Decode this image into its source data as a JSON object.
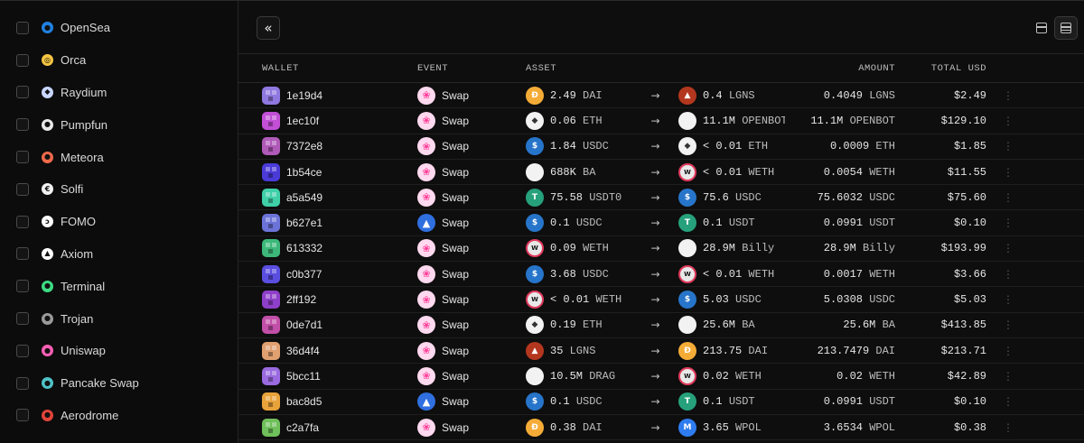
{
  "sidebar": {
    "items": [
      {
        "label": "OpenSea",
        "icon": "opensea-icon",
        "color": "#2081e2",
        "glyph": "●"
      },
      {
        "label": "Orca",
        "icon": "orca-icon",
        "color": "#f5c542",
        "glyph": "◎"
      },
      {
        "label": "Raydium",
        "icon": "raydium-icon",
        "color": "#c9d6ff",
        "glyph": "◆"
      },
      {
        "label": "Pumpfun",
        "icon": "pumpfun-icon",
        "color": "#e8e8e8",
        "glyph": "●"
      },
      {
        "label": "Meteora",
        "icon": "meteora-icon",
        "color": "#f06a4a",
        "glyph": "●"
      },
      {
        "label": "Solfi",
        "icon": "solfi-icon",
        "color": "#f2f2f2",
        "glyph": "€"
      },
      {
        "label": "FOMO",
        "icon": "fomo-icon",
        "color": "#ffffff",
        "glyph": "ↄ"
      },
      {
        "label": "Axiom",
        "icon": "axiom-icon",
        "color": "#ffffff",
        "glyph": "▲"
      },
      {
        "label": "Terminal",
        "icon": "terminal-icon",
        "color": "#3ddc84",
        "glyph": "●"
      },
      {
        "label": "Trojan",
        "icon": "trojan-icon",
        "color": "#9a9a9a",
        "glyph": "●"
      },
      {
        "label": "Uniswap",
        "icon": "uniswap-icon",
        "color": "#ff5fb4",
        "glyph": "●"
      },
      {
        "label": "Pancake Swap",
        "icon": "pancakeswap-icon",
        "color": "#4fc3c7",
        "glyph": "●"
      },
      {
        "label": "Aerodrome",
        "icon": "aerodrome-icon",
        "color": "#e3433a",
        "glyph": "●"
      }
    ]
  },
  "table": {
    "headers": {
      "wallet": "WALLET",
      "event": "EVENT",
      "asset": "ASSET",
      "amount": "AMOUNT",
      "total": "TOTAL USD"
    },
    "arrow": "→",
    "rows": [
      {
        "wallet": "1e19d4",
        "avatar_color": "#8f79e0",
        "event": "Swap",
        "event_icon": "uniswap-icon",
        "in_amt": "2.49",
        "in_sym": "DAI",
        "in_icon": "dai-icon",
        "in_color": "#f5ac37",
        "in_glyph": "Đ",
        "out_amt": "0.4",
        "out_sym": "LGNS",
        "out_icon": "lgns-icon",
        "out_color": "#b3371e",
        "out_glyph": "▲",
        "amount": "0.4049",
        "amount_sym": "LGNS",
        "total": "$2.49"
      },
      {
        "wallet": "1ec10f",
        "avatar_color": "#c24fd6",
        "event": "Swap",
        "event_icon": "uniswap-icon",
        "in_amt": "0.06",
        "in_sym": "ETH",
        "in_icon": "eth-icon",
        "in_color": "#f2f2f2",
        "in_glyph": "◆",
        "out_amt": "11.1M",
        "out_sym": "OPENBOT",
        "out_icon": "openbot-icon",
        "out_color": "#f2f2f2",
        "out_glyph": "",
        "amount": "11.1M",
        "amount_sym": "OPENBOT",
        "total": "$129.10"
      },
      {
        "wallet": "7372e8",
        "avatar_color": "#b05ab8",
        "event": "Swap",
        "event_icon": "uniswap-icon",
        "in_amt": "1.84",
        "in_sym": "USDC",
        "in_icon": "usdc-icon",
        "in_color": "#2775ca",
        "in_glyph": "$",
        "out_amt": "< 0.01",
        "out_sym": "ETH",
        "out_icon": "eth-icon",
        "out_color": "#f2f2f2",
        "out_glyph": "◆",
        "amount": "0.0009",
        "amount_sym": "ETH",
        "total": "$1.85"
      },
      {
        "wallet": "1b54ce",
        "avatar_color": "#4a3bd9",
        "event": "Swap",
        "event_icon": "uniswap-icon",
        "in_amt": "688K",
        "in_sym": "BA",
        "in_icon": "ba-icon",
        "in_color": "#f2f2f2",
        "in_glyph": "",
        "out_amt": "< 0.01",
        "out_sym": "WETH",
        "out_icon": "weth-icon",
        "out_color": "#e8e8e8",
        "out_glyph": "W",
        "amount": "0.0054",
        "amount_sym": "WETH",
        "total": "$11.55"
      },
      {
        "wallet": "a5a549",
        "avatar_color": "#3fd0a8",
        "event": "Swap",
        "event_icon": "uniswap-icon",
        "in_amt": "75.58",
        "in_sym": "USDT0",
        "in_icon": "usdt0-icon",
        "in_color": "#26a17b",
        "in_glyph": "T",
        "out_amt": "75.6",
        "out_sym": "USDC",
        "out_icon": "usdc-icon",
        "out_color": "#2775ca",
        "out_glyph": "$",
        "amount": "75.6032",
        "amount_sym": "USDC",
        "total": "$75.60"
      },
      {
        "wallet": "b627e1",
        "avatar_color": "#6b73d8",
        "event": "Swap",
        "event_icon": "pancakeswap-icon",
        "in_amt": "0.1",
        "in_sym": "USDC",
        "in_icon": "usdc-icon",
        "in_color": "#2775ca",
        "in_glyph": "$",
        "out_amt": "0.1",
        "out_sym": "USDT",
        "out_icon": "usdt-icon",
        "out_color": "#26a17b",
        "out_glyph": "T",
        "amount": "0.0991",
        "amount_sym": "USDT",
        "total": "$0.10"
      },
      {
        "wallet": "613332",
        "avatar_color": "#3db87a",
        "event": "Swap",
        "event_icon": "uniswap-icon",
        "in_amt": "0.09",
        "in_sym": "WETH",
        "in_icon": "weth-icon",
        "in_color": "#e8e8e8",
        "in_glyph": "W",
        "out_amt": "28.9M",
        "out_sym": "Billy",
        "out_icon": "billy-icon",
        "out_color": "#f2f2f2",
        "out_glyph": "",
        "amount": "28.9M",
        "amount_sym": "Billy",
        "total": "$193.99"
      },
      {
        "wallet": "c0b377",
        "avatar_color": "#5a4ee0",
        "event": "Swap",
        "event_icon": "uniswap-icon",
        "in_amt": "3.68",
        "in_sym": "USDC",
        "in_icon": "usdc-icon",
        "in_color": "#2775ca",
        "in_glyph": "$",
        "out_amt": "< 0.01",
        "out_sym": "WETH",
        "out_icon": "weth-icon",
        "out_color": "#e8e8e8",
        "out_glyph": "W",
        "amount": "0.0017",
        "amount_sym": "WETH",
        "total": "$3.66"
      },
      {
        "wallet": "2ff192",
        "avatar_color": "#8e3fc9",
        "event": "Swap",
        "event_icon": "uniswap-icon",
        "in_amt": "< 0.01",
        "in_sym": "WETH",
        "in_icon": "weth-icon",
        "in_color": "#e8e8e8",
        "in_glyph": "W",
        "out_amt": "5.03",
        "out_sym": "USDC",
        "out_icon": "usdc-icon",
        "out_color": "#2775ca",
        "out_glyph": "$",
        "amount": "5.0308",
        "amount_sym": "USDC",
        "total": "$5.03"
      },
      {
        "wallet": "0de7d1",
        "avatar_color": "#c24fa8",
        "event": "Swap",
        "event_icon": "uniswap-icon",
        "in_amt": "0.19",
        "in_sym": "ETH",
        "in_icon": "eth-icon",
        "in_color": "#f2f2f2",
        "in_glyph": "◆",
        "out_amt": "25.6M",
        "out_sym": "BA",
        "out_icon": "ba-icon",
        "out_color": "#f2f2f2",
        "out_glyph": "",
        "amount": "25.6M",
        "amount_sym": "BA",
        "total": "$413.85"
      },
      {
        "wallet": "36d4f4",
        "avatar_color": "#e0a070",
        "event": "Swap",
        "event_icon": "uniswap-icon",
        "in_amt": "35",
        "in_sym": "LGNS",
        "in_icon": "lgns-icon",
        "in_color": "#b3371e",
        "in_glyph": "▲",
        "out_amt": "213.75",
        "out_sym": "DAI",
        "out_icon": "dai-icon",
        "out_color": "#f5ac37",
        "out_glyph": "Đ",
        "amount": "213.7479",
        "amount_sym": "DAI",
        "total": "$213.71"
      },
      {
        "wallet": "5bcc11",
        "avatar_color": "#9a6ae0",
        "event": "Swap",
        "event_icon": "uniswap-icon",
        "in_amt": "10.5M",
        "in_sym": "DRAG",
        "in_icon": "drag-icon",
        "in_color": "#f2f2f2",
        "in_glyph": "",
        "out_amt": "0.02",
        "out_sym": "WETH",
        "out_icon": "weth-icon",
        "out_color": "#e8e8e8",
        "out_glyph": "W",
        "amount": "0.02",
        "amount_sym": "WETH",
        "total": "$42.89"
      },
      {
        "wallet": "bac8d5",
        "avatar_color": "#e8a23a",
        "event": "Swap",
        "event_icon": "pancakeswap-icon",
        "in_amt": "0.1",
        "in_sym": "USDC",
        "in_icon": "usdc-icon",
        "in_color": "#2775ca",
        "in_glyph": "$",
        "out_amt": "0.1",
        "out_sym": "USDT",
        "out_icon": "usdt-icon",
        "out_color": "#26a17b",
        "out_glyph": "T",
        "amount": "0.0991",
        "amount_sym": "USDT",
        "total": "$0.10"
      },
      {
        "wallet": "c2a7fa",
        "avatar_color": "#6fbf5a",
        "event": "Swap",
        "event_icon": "uniswap-icon",
        "in_amt": "0.38",
        "in_sym": "DAI",
        "in_icon": "dai-icon",
        "in_color": "#f5ac37",
        "in_glyph": "Đ",
        "out_amt": "3.65",
        "out_sym": "WPOL",
        "out_icon": "wpol-icon",
        "out_color": "#2f7cf0",
        "out_glyph": "M",
        "amount": "3.6534",
        "amount_sym": "WPOL",
        "total": "$0.38"
      }
    ]
  },
  "toolbar": {
    "collapse_glyph": "«"
  },
  "colors": {
    "uniswap": "#ffd9ef",
    "pancake": "#1fc7d4",
    "weth_ring": "#e03a5c"
  }
}
